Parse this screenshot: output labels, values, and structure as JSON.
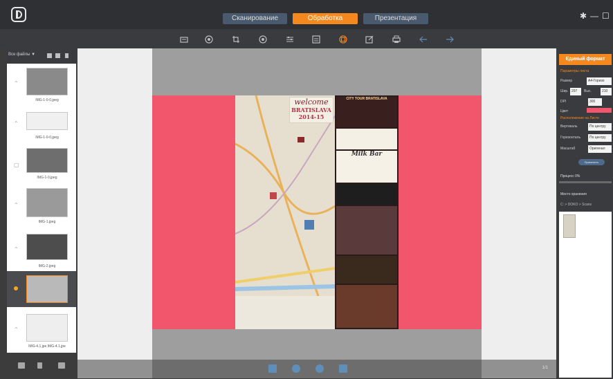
{
  "app": {
    "modes": [
      "Сканирование",
      "Обработка",
      "Презентация"
    ],
    "active_mode": "Обработка",
    "accent_color": "#f5891e"
  },
  "toolbar": {
    "icons": [
      "scan-icon",
      "settings-icon",
      "crop-icon",
      "target-icon",
      "adjust-icon",
      "layout-icon",
      "merge-icon",
      "edit-icon",
      "print-icon",
      "undo-icon",
      "redo-icon"
    ]
  },
  "sidebar": {
    "filter_label": "Все файлы ▼",
    "items": [
      {
        "caption": "IMG-1-0-0.jpeg"
      },
      {
        "caption": "IMG-1-0-0.jpeg"
      },
      {
        "caption": "IMG-1-0.jpeg"
      },
      {
        "caption": "IMG-1.jpeg"
      },
      {
        "caption": "IMG-2.jpeg"
      },
      {
        "caption": ""
      },
      {
        "caption": "IMG-4.1.jpe IMG-4.1.jpe"
      }
    ]
  },
  "document": {
    "welcome_line1": "welcome",
    "welcome_line2": "BRATISLAVA",
    "welcome_line3": "2014-15",
    "ad_city_tour": "CITY TOUR BRATISLAVA",
    "ad_milk_bar": "Milk Bar"
  },
  "canvas": {
    "page_indicator": "1/1"
  },
  "right_panel": {
    "unify_button": "Единый формат",
    "section_page": "Параметры листа",
    "size_label": "Размер",
    "size_value": "A4-Горизо",
    "width_label": "Шир.",
    "width_value": "297",
    "height_label": "Выс.",
    "height_value": "210",
    "dpi_label": "DPI",
    "dpi_value": "300",
    "color_label": "Цвет",
    "section_layout": "Расположение на Листе",
    "vertical_label": "Вертикаль",
    "vertical_value": "По центру",
    "horizontal_label": "Горизонталь",
    "horizontal_value": "По центру",
    "scale_label": "Масштаб",
    "scale_value": "Оригинал",
    "apply_button": "Применить",
    "progress_label": "Процесс 0%",
    "progress_value": 0,
    "storage_label": "Место хранения",
    "storage_path": "C: > DOKO > Scans"
  }
}
